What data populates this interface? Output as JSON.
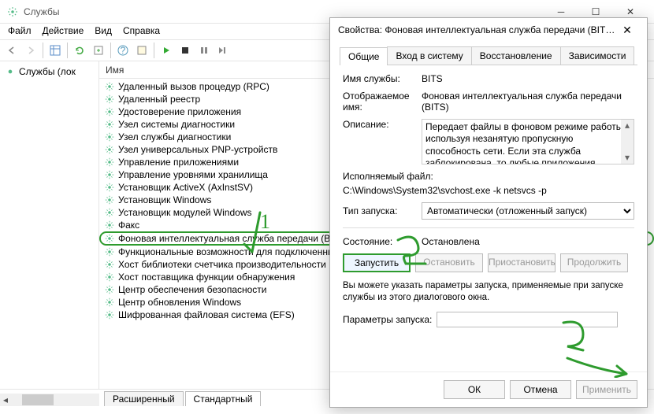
{
  "window": {
    "title": "Службы",
    "menu": [
      "Файл",
      "Действие",
      "Вид",
      "Справка"
    ],
    "left_panel_label": "Службы (лок",
    "column_header": "Имя",
    "tabs": {
      "extended": "Расширенный",
      "standard": "Стандартный"
    }
  },
  "services": [
    "Удаленный вызов процедур (RPC)",
    "Удаленный реестр",
    "Удостоверение приложения",
    "Узел системы диагностики",
    "Узел службы диагностики",
    "Узел универсальных PNP-устройств",
    "Управление приложениями",
    "Управление уровнями хранилища",
    "Установщик ActiveX (AxInstSV)",
    "Установщик Windows",
    "Установщик модулей Windows",
    "Факс",
    "Фоновая интеллектуальная служба передачи (BITS)",
    "Функциональные возможности для подключенны...",
    "Хост библиотеки счетчика производительности",
    "Хост поставщика функции обнаружения",
    "Центр обеспечения безопасности",
    "Центр обновления Windows",
    "Шифрованная файловая система (EFS)"
  ],
  "selected_service_index": 12,
  "dialog": {
    "title": "Свойства: Фоновая интеллектуальная служба передачи (BITS) (...",
    "tabs": [
      "Общие",
      "Вход в систему",
      "Восстановление",
      "Зависимости"
    ],
    "active_tab_index": 0,
    "labels": {
      "service_name": "Имя службы:",
      "display_name": "Отображаемое имя:",
      "description": "Описание:",
      "executable": "Исполняемый файл:",
      "startup_type": "Тип запуска:",
      "state": "Состояние:",
      "start_params": "Параметры запуска:"
    },
    "values": {
      "service_name": "BITS",
      "display_name": "Фоновая интеллектуальная служба передачи (BITS)",
      "description": "Передает файлы в фоновом режиме работы, используя незанятую пропускную способность сети. Если эта служба заблокирована, то любые приложения, зависящие от BITS, такие",
      "executable": "C:\\Windows\\System32\\svchost.exe -k netsvcs -p",
      "startup_type": "Автоматически (отложенный запуск)",
      "state": "Остановлена",
      "start_params": ""
    },
    "buttons": {
      "start": "Запустить",
      "stop": "Остановить",
      "pause": "Приостановить",
      "resume": "Продолжить"
    },
    "note": "Вы можете указать параметры запуска, применяемые при запуске службы из этого диалогового окна.",
    "actions": {
      "ok": "ОК",
      "cancel": "Отмена",
      "apply": "Применить"
    }
  }
}
